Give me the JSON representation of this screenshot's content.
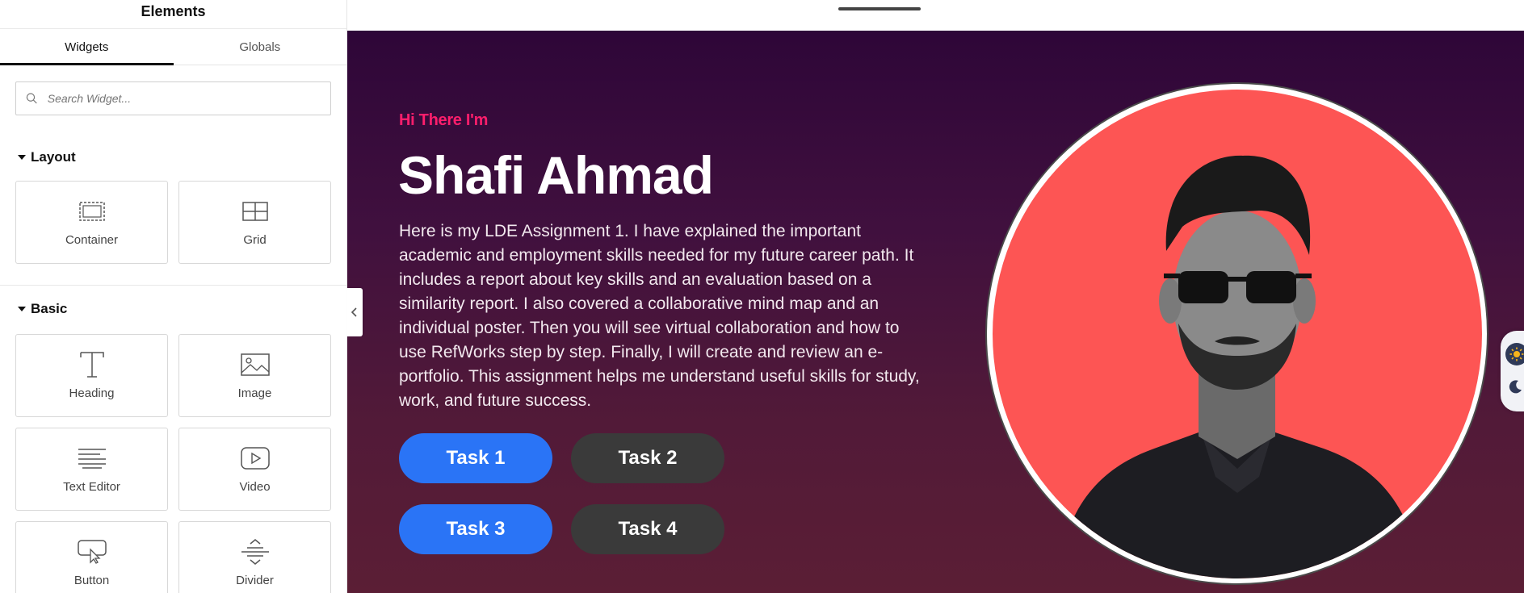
{
  "sidebar": {
    "title": "Elements",
    "tabs": [
      {
        "label": "Widgets"
      },
      {
        "label": "Globals"
      }
    ],
    "search_placeholder": "Search Widget...",
    "sections": {
      "layout": {
        "title": "Layout",
        "widgets": [
          {
            "label": "Container",
            "icon": "container-icon"
          },
          {
            "label": "Grid",
            "icon": "grid-icon"
          }
        ]
      },
      "basic": {
        "title": "Basic",
        "widgets": [
          {
            "label": "Heading",
            "icon": "heading-icon"
          },
          {
            "label": "Image",
            "icon": "image-icon"
          },
          {
            "label": "Text Editor",
            "icon": "text-editor-icon"
          },
          {
            "label": "Video",
            "icon": "video-icon"
          },
          {
            "label": "Button",
            "icon": "button-icon"
          },
          {
            "label": "Divider",
            "icon": "divider-icon"
          }
        ]
      }
    }
  },
  "hero": {
    "intro": "Hi There I'm",
    "name": "Shafi Ahmad",
    "description": "Here is my LDE Assignment 1. I have explained the important academic and employment skills needed for my future career path. It includes a report about key skills and an evaluation based on a similarity report. I also covered a collaborative mind map and an individual poster. Then you will see virtual collaboration and how to use RefWorks step by step. Finally, I will create and review an e-portfolio. This assignment helps me understand useful skills for study, work, and future success.",
    "buttons": [
      {
        "label": "Task 1"
      },
      {
        "label": "Task 2"
      },
      {
        "label": "Task 3"
      },
      {
        "label": "Task 4"
      }
    ]
  },
  "colors": {
    "accent_pink": "#ff1e6c",
    "button_blue": "#2a74f6",
    "button_dark": "#3a3a3a",
    "photo_background": "#fd5554"
  }
}
